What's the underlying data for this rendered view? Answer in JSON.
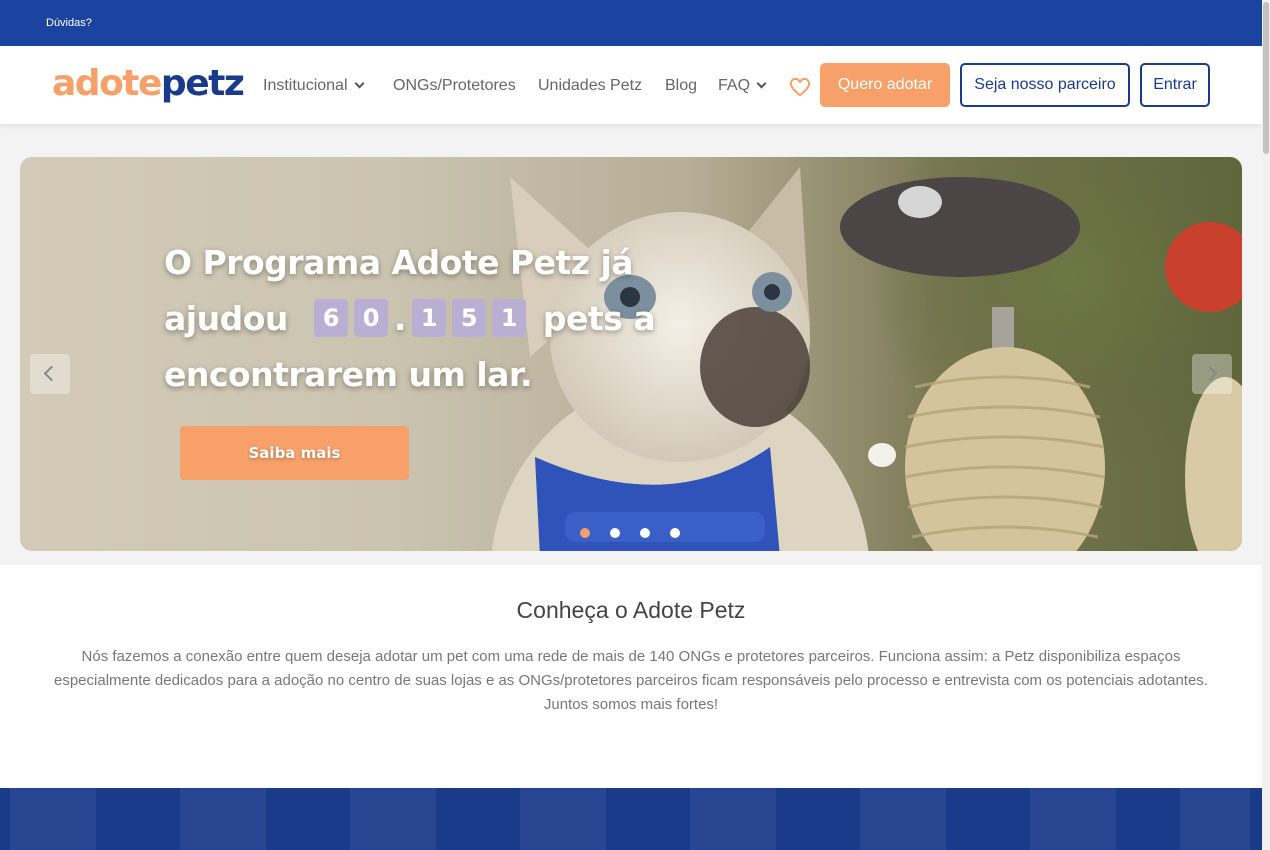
{
  "topbar": {
    "help_link": "Dúvidas?"
  },
  "logo": {
    "part1": "adote",
    "part2": "petz"
  },
  "nav": {
    "items": [
      {
        "label": "Institucional",
        "has_dropdown": true
      },
      {
        "label": "ONGs/Protetores",
        "has_dropdown": false
      },
      {
        "label": "Unidades Petz",
        "has_dropdown": false
      },
      {
        "label": "Blog",
        "has_dropdown": false
      },
      {
        "label": "FAQ",
        "has_dropdown": true
      }
    ],
    "favorites_icon": "heart-icon",
    "cta_primary": "Quero adotar",
    "cta_partner": "Seja nosso parceiro",
    "cta_login": "Entrar"
  },
  "hero": {
    "title_line1": "O Programa Adote Petz já",
    "title_ajudou": "ajudou",
    "counter": [
      "6",
      "0",
      ".",
      "1",
      "5",
      "1"
    ],
    "title_after_counter": "pets a",
    "title_line3": "encontrarem um lar.",
    "button": "Saiba mais",
    "slides_count": 4,
    "active_slide": 1,
    "prev_icon": "chevron-left-icon",
    "next_icon": "chevron-right-icon"
  },
  "about": {
    "title": "Conheça o Adote Petz",
    "text": "Nós fazemos a conexão entre quem deseja adotar um pet com uma rede de mais de 140 ONGs e protetores parceiros. Funciona assim: a Petz disponibiliza espaços especialmente dedicados para a adoção no centro de suas lojas e as ONGs/protetores parceiros ficam responsáveis pelo processo e entrevista com os potenciais adotantes. Juntos somos mais fortes!"
  },
  "colors": {
    "brand_blue": "#1a44a0",
    "brand_navy": "#1a3a8a",
    "brand_orange": "#f7a06a",
    "counter_purple": "#b9afd3"
  }
}
